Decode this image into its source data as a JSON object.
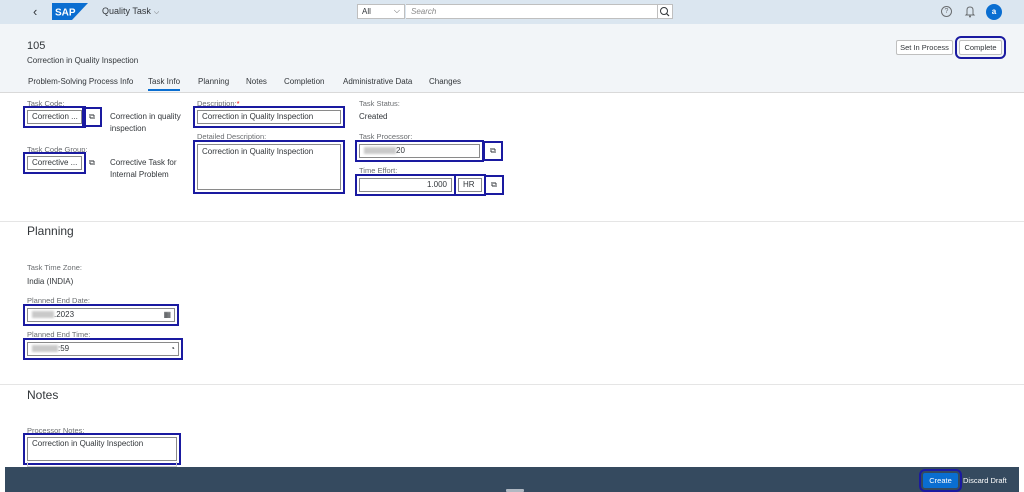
{
  "shell": {
    "back_icon": "chevron-left-icon",
    "brand": "SAP",
    "app_title": "Quality Task",
    "scope_value": "All",
    "search_placeholder": "Search",
    "avatar_initial": "a"
  },
  "header": {
    "object_id": "105",
    "object_subtitle": "Correction in Quality Inspection",
    "set_in_process_label": "Set In Process",
    "complete_label": "Complete"
  },
  "tabs": [
    "Problem-Solving Process Info",
    "Task Info",
    "Planning",
    "Notes",
    "Completion",
    "Administrative Data",
    "Changes"
  ],
  "task_info": {
    "task_code_label": "Task Code:",
    "task_code_value": "Correction ...",
    "task_code_desc": "Correction in quality inspection",
    "task_code_group_label": "Task Code Group:",
    "task_code_group_value": "Corrective ...",
    "task_code_group_desc": "Corrective Task for Internal Problem",
    "description_label": "Description:",
    "required_mark": "*",
    "description_value": "Correction in Quality Inspection",
    "detailed_description_label": "Detailed Description:",
    "detailed_description_value": "Correction in Quality Inspection",
    "task_status_label": "Task Status:",
    "task_status_value": "Created",
    "task_processor_label": "Task Processor:",
    "task_processor_value": "20",
    "time_effort_label": "Time Effort:",
    "time_effort_value": "1.000",
    "time_effort_unit": "HR"
  },
  "planning": {
    "title": "Planning",
    "time_zone_label": "Task Time Zone:",
    "time_zone_value": "India (INDIA)",
    "end_date_label": "Planned End Date:",
    "end_date_value": ".2023",
    "end_time_label": "Planned End Time:",
    "end_time_value": ":59"
  },
  "notes": {
    "title": "Notes",
    "processor_notes_label": "Processor Notes:",
    "processor_notes_value": "Correction in Quality Inspection"
  },
  "footer": {
    "create_label": "Create",
    "discard_label": "Discard Draft"
  }
}
